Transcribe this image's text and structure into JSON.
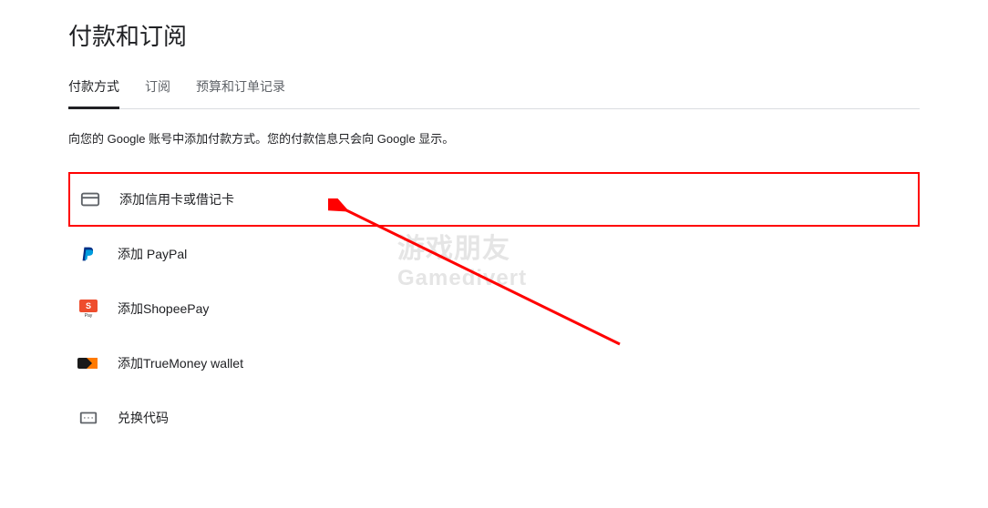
{
  "page_title": "付款和订阅",
  "tabs": [
    {
      "label": "付款方式",
      "active": true
    },
    {
      "label": "订阅",
      "active": false
    },
    {
      "label": "预算和订单记录",
      "active": false
    }
  ],
  "description": "向您的 Google 账号中添加付款方式。您的付款信息只会向 Google 显示。",
  "payment_options": [
    {
      "icon": "credit-card-icon",
      "label": "添加信用卡或借记卡",
      "highlighted": true
    },
    {
      "icon": "paypal-icon",
      "label": "添加 PayPal",
      "highlighted": false
    },
    {
      "icon": "shopeepay-icon",
      "label": "添加ShopeePay",
      "highlighted": false
    },
    {
      "icon": "truemoney-icon",
      "label": "添加TrueMoney wallet",
      "highlighted": false
    },
    {
      "icon": "redeem-code-icon",
      "label": "兑换代码",
      "highlighted": false
    }
  ],
  "watermark": {
    "line1": "游戏朋友",
    "line2": "Gamedivert"
  }
}
